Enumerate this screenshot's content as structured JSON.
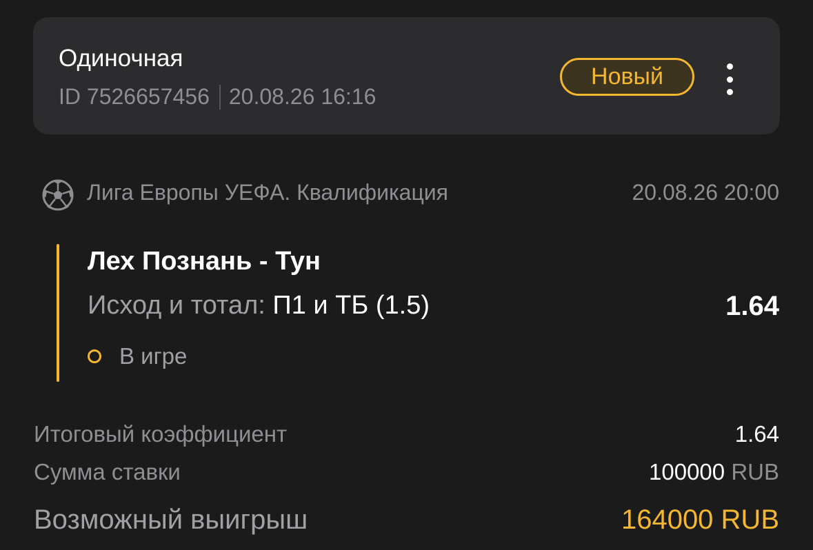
{
  "header": {
    "bet_type": "Одиночная",
    "bet_id": "ID 7526657456",
    "bet_datetime": "20.08.26 16:16",
    "status_badge": "Новый",
    "more_icon": "more-vertical-icon"
  },
  "event": {
    "sport_icon": "soccer-ball-icon",
    "league": "Лига Европы УЕФА. Квалификация",
    "start_time": "20.08.26 20:00",
    "teams": "Лех Познань - Тун",
    "market_label": "Исход и тотал:",
    "selection": "П1 и ТБ (1.5)",
    "odds": "1.64",
    "status": "В игре"
  },
  "summary": {
    "total_odds_label": "Итоговый коэффициент",
    "total_odds_value": "1.64",
    "stake_label": "Сумма ставки",
    "stake_amount": "100000",
    "stake_currency": "RUB",
    "payout_label": "Возможный выигрыш",
    "payout_value": "164000 RUB"
  },
  "colors": {
    "background": "#1b1b1c",
    "card": "#2c2c2e",
    "accent": "#f5b630",
    "muted_text": "#8e8e93"
  }
}
